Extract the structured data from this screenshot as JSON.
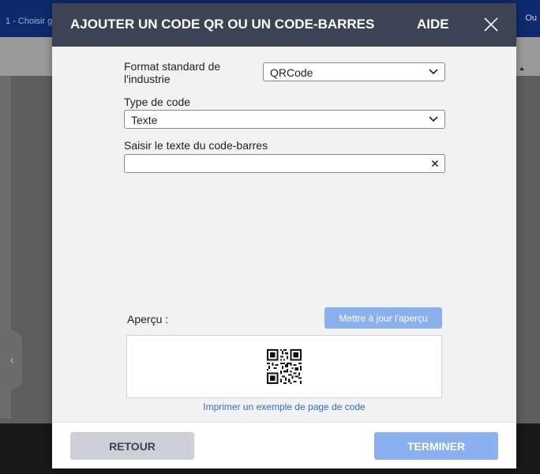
{
  "background": {
    "tab_label": "1 - Choisir g",
    "right_label": "Ou"
  },
  "dialog": {
    "title": "AJOUTER UN CODE QR OU UN CODE-BARRES",
    "help_label": "AIDE",
    "format": {
      "label": "Format standard de l'industrie",
      "value": "QRCode"
    },
    "code_type": {
      "label": "Type de code",
      "value": "Texte"
    },
    "barcode_text": {
      "label": "Saisir le texte du code-barres",
      "value": "",
      "placeholder": ""
    },
    "preview": {
      "label": "Aperçu :",
      "refresh_button": "Mettre à jour l'aperçu",
      "print_sample_link": "Imprimer un exemple de page de code"
    },
    "footer": {
      "back_button": "RETOUR",
      "finish_button": "TERMINER"
    }
  },
  "colors": {
    "header_bg": "#3c4354",
    "primary_disabled": "#8ab0ee",
    "link": "#2a6fd6",
    "app_topbar": "#0d2a6e"
  },
  "icons": {
    "close": "close-icon",
    "chevron": "chevron-down-icon",
    "clear": "clear-icon",
    "qr": "qr-code-icon",
    "left": "chevron-left-icon"
  }
}
